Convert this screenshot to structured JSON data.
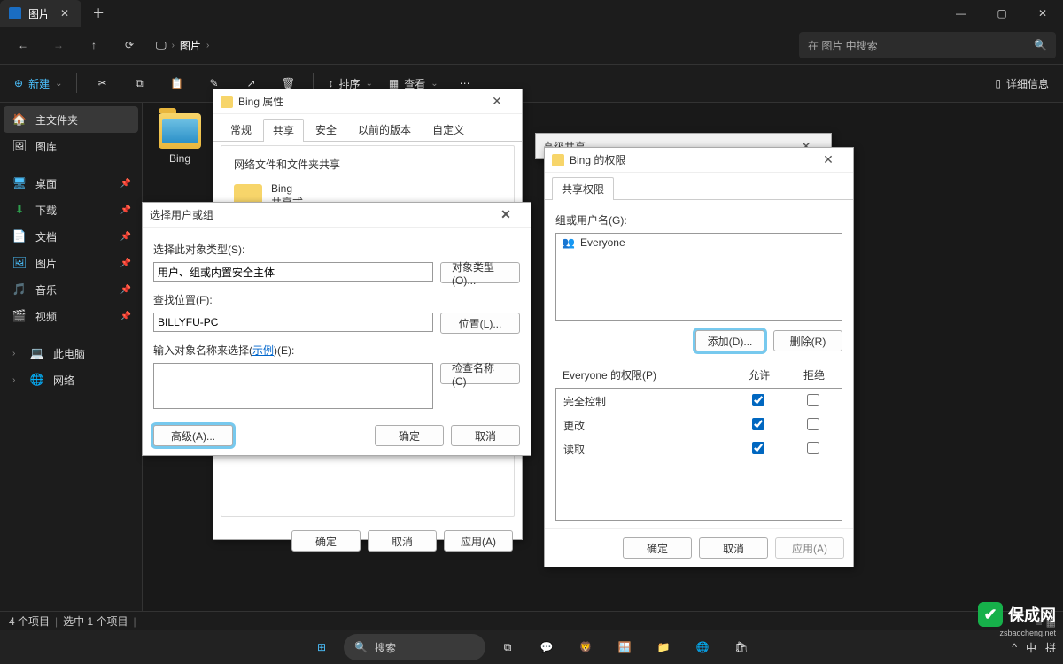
{
  "explorer": {
    "tab_title": "图片",
    "breadcrumb_item": "图片",
    "search_placeholder": "在 图片 中搜索",
    "toolbar": {
      "new": "新建",
      "sort": "排序",
      "view": "查看",
      "details": "详细信息"
    },
    "sidebar": {
      "home": "主文件夹",
      "gallery": "图库",
      "desktop": "桌面",
      "downloads": "下载",
      "documents": "文档",
      "pictures": "图片",
      "music": "音乐",
      "videos": "视频",
      "this_pc": "此电脑",
      "network": "网络"
    },
    "folder_name": "Bing",
    "status_items": "4 个项目",
    "status_selected": "选中 1 个项目"
  },
  "properties": {
    "title": "Bing 属性",
    "tabs": {
      "general": "常规",
      "share": "共享",
      "security": "安全",
      "previous": "以前的版本",
      "custom": "自定义"
    },
    "section_title": "网络文件和文件夹共享",
    "item_name": "Bing",
    "item_status": "共享式",
    "ok": "确定",
    "cancel": "取消",
    "apply": "应用(A)"
  },
  "select_user": {
    "title": "选择用户或组",
    "object_type_label": "选择此对象类型(S):",
    "object_type_value": "用户、组或内置安全主体",
    "object_type_btn": "对象类型(O)...",
    "location_label": "查找位置(F):",
    "location_value": "BILLYFU-PC",
    "location_btn": "位置(L)...",
    "names_label_pre": "输入对象名称来选择(",
    "names_label_link": "示例",
    "names_label_post": ")(E):",
    "check_names_btn": "检查名称(C)",
    "advanced_btn": "高级(A)...",
    "ok": "确定",
    "cancel": "取消"
  },
  "adv_share": {
    "title": "高级共享"
  },
  "permissions": {
    "title": "Bing 的权限",
    "tab": "共享权限",
    "group_label": "组或用户名(G):",
    "user": "Everyone",
    "add_btn": "添加(D)...",
    "remove_btn": "删除(R)",
    "perm_label": "Everyone 的权限(P)",
    "allow": "允许",
    "deny": "拒绝",
    "rows": {
      "full": "完全控制",
      "change": "更改",
      "read": "读取"
    },
    "ok": "确定",
    "cancel": "取消",
    "apply": "应用(A)"
  },
  "taskbar": {
    "search": "搜索",
    "lang": "中"
  },
  "watermark": {
    "text": "保成网",
    "sub": "zsbaocheng.net"
  }
}
